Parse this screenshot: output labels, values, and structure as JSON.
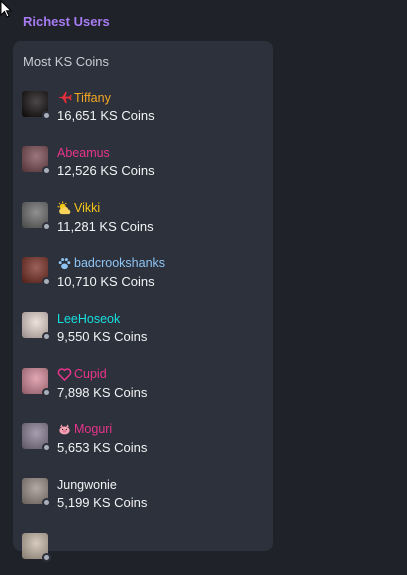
{
  "section": {
    "title": "Richest Users"
  },
  "card": {
    "title": "Most KS Coins"
  },
  "users": [
    {
      "name": "Tiffany",
      "coins": "16,651 KS Coins",
      "name_color": "#f5a623",
      "icon": "airplane-icon",
      "icon_color": "#e5303a",
      "avatar_bg": "#0f0a0b"
    },
    {
      "name": "Abeamus",
      "coins": "12,526 KS Coins",
      "name_color": "#e8348c",
      "icon": "",
      "icon_color": "",
      "avatar_bg": "#7a4a52"
    },
    {
      "name": "Vikki",
      "coins": "11,281 KS Coins",
      "name_color": "#f5c518",
      "icon": "cloud-sun-icon",
      "icon_color": "#f5c518",
      "avatar_bg": "#6b6b6b"
    },
    {
      "name": "badcrookshanks",
      "coins": "10,710 KS Coins",
      "name_color": "#8ec5f5",
      "icon": "paw-icon",
      "icon_color": "#8ec5f5",
      "avatar_bg": "#7a2d22"
    },
    {
      "name": "LeeHoseok",
      "coins": "9,550 KS Coins",
      "name_color": "#16e0e0",
      "icon": "",
      "icon_color": "",
      "avatar_bg": "#e7d7cf"
    },
    {
      "name": "Cupid",
      "coins": "7,898 KS Coins",
      "name_color": "#e8348c",
      "icon": "heart-outline-icon",
      "icon_color": "#e8348c",
      "avatar_bg": "#d88a9a"
    },
    {
      "name": "Moguri",
      "coins": "5,653 KS Coins",
      "name_color": "#e8348c",
      "icon": "pig-icon",
      "icon_color": "#f5a3b5",
      "avatar_bg": "#8a7f95"
    },
    {
      "name": "Jungwonie",
      "coins": "5,199 KS Coins",
      "name_color": "#f2f3f5",
      "icon": "",
      "icon_color": "",
      "avatar_bg": "#9a8d86"
    },
    {
      "name": "",
      "coins": "",
      "name_color": "#e8348c",
      "icon": "",
      "icon_color": "",
      "avatar_bg": "#c9b9a8"
    }
  ]
}
